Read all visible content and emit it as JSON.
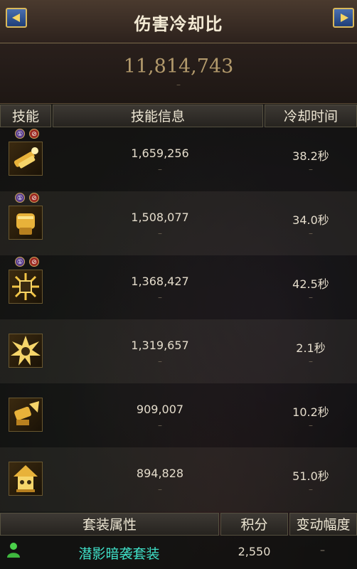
{
  "header": {
    "title": "伤害冷却比",
    "total": "11,814,743",
    "total_sub": "–"
  },
  "columns": {
    "skill": "技能",
    "info": "技能信息",
    "cooldown": "冷却时间"
  },
  "skills": [
    {
      "value": "1,659,256",
      "sub": "–",
      "cooldown": "38.2秒",
      "badges": [
        "①",
        "⊘"
      ],
      "icon": "rocket-skill-icon"
    },
    {
      "value": "1,508,077",
      "sub": "–",
      "cooldown": "34.0秒",
      "badges": [
        "①",
        "⊘"
      ],
      "icon": "gold-fist-skill-icon"
    },
    {
      "value": "1,368,427",
      "sub": "–",
      "cooldown": "42.5秒",
      "badges": [
        "①",
        "⊘"
      ],
      "icon": "burst-skill-icon"
    },
    {
      "value": "1,319,657",
      "sub": "–",
      "cooldown": "2.1秒",
      "badges": [],
      "icon": "explosion-skill-icon"
    },
    {
      "value": "909,007",
      "sub": "–",
      "cooldown": "10.2秒",
      "badges": [],
      "icon": "cannon-skill-icon"
    },
    {
      "value": "894,828",
      "sub": "–",
      "cooldown": "51.0秒",
      "badges": [],
      "icon": "robot-skill-icon"
    }
  ],
  "set_section": {
    "headers": {
      "attribute": "套装属性",
      "score": "积分",
      "change": "变动幅度"
    },
    "set_name": "潜影暗袭套装",
    "score": "2,550",
    "change": "–"
  },
  "colors": {
    "accent_gold": "#f2c445",
    "set_name": "#3fe0c8"
  }
}
